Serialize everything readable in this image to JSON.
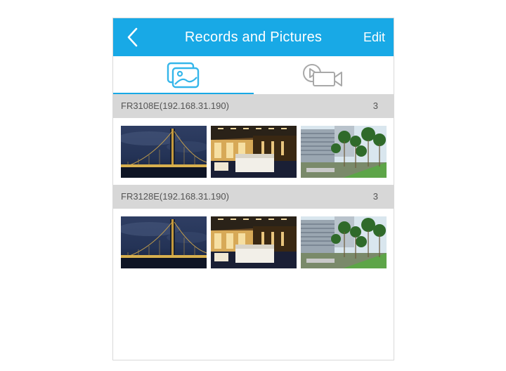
{
  "header": {
    "title": "Records and Pictures",
    "edit_label": "Edit",
    "back_icon": "chevron-left-icon",
    "color": "#18a9e6"
  },
  "tabs": [
    {
      "icon": "picture-icon",
      "active": true
    },
    {
      "icon": "video-icon",
      "active": false
    }
  ],
  "groups": [
    {
      "device": "FR3108E(192.168.31.190)",
      "count": "3",
      "thumbnails": [
        "bridge-night-photo",
        "hotel-room-photo",
        "office-building-photo"
      ]
    },
    {
      "device": "FR3128E(192.168.31.190)",
      "count": "3",
      "thumbnails": [
        "bridge-night-photo",
        "hotel-room-photo",
        "office-building-photo"
      ]
    }
  ]
}
